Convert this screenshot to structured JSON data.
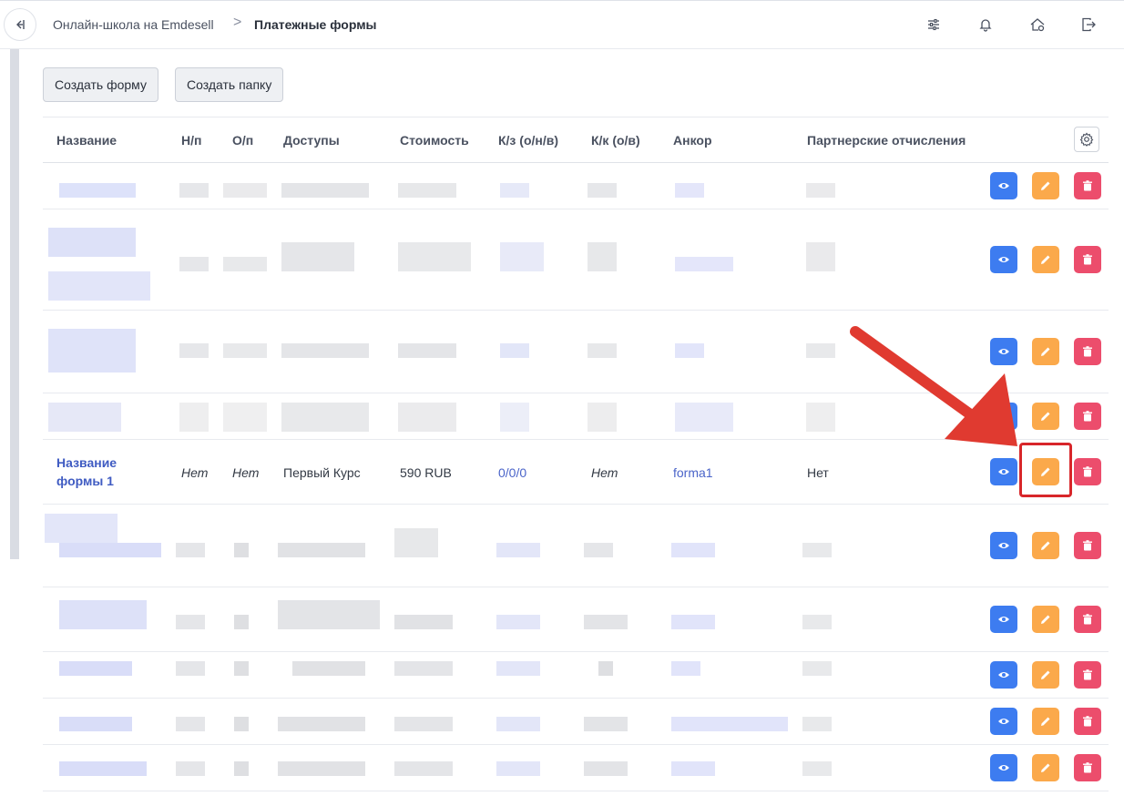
{
  "breadcrumb": {
    "parent": "Онлайн-школа на Emdesell",
    "separator": ">",
    "current": "Платежные формы"
  },
  "toolbar": {
    "create_form": "Создать форму",
    "create_folder": "Создать папку"
  },
  "table": {
    "headers": [
      "Название",
      "Н/п",
      "О/п",
      "Доступы",
      "Стоимость",
      "К/з (о/н/в)",
      "К/к (о/в)",
      "Анкор",
      "Партнерские отчисления"
    ],
    "visible_row": {
      "name": "Название формы 1",
      "np": "Нет",
      "op": "Нет",
      "access": "Первый Курс",
      "price": "590 RUB",
      "kz": "0/0/0",
      "kk": "Нет",
      "anchor": "forma1",
      "partner": "Нет"
    }
  },
  "icons": {
    "collapse": "collapse-sidebar-icon",
    "filters": "sliders-icon",
    "notifications": "bell-icon",
    "home": "home-settings-icon",
    "logout": "logout-icon",
    "table_settings": "gear-icon",
    "view": "eye-icon",
    "edit": "pencil-icon",
    "delete": "trash-icon"
  },
  "colors": {
    "view_button": "#3d7cf0",
    "edit_button": "#fba94b",
    "delete_button": "#ec4d6c",
    "highlight": "#d8262a",
    "link": "#3f5bc2"
  }
}
